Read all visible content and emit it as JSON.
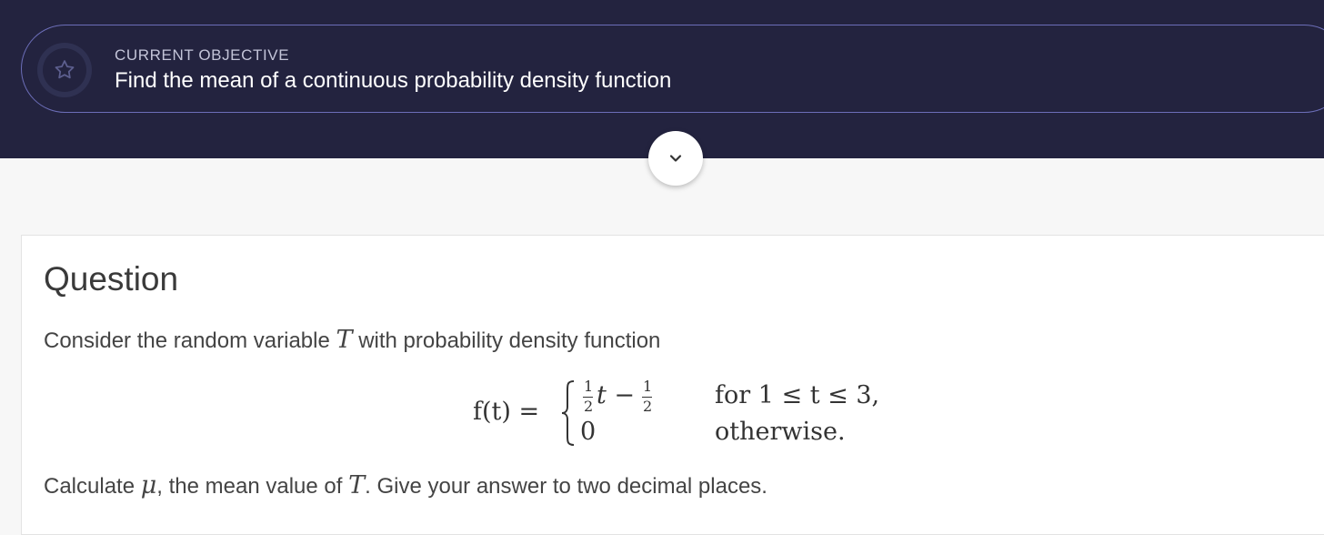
{
  "header": {
    "objective_label": "CURRENT OBJECTIVE",
    "objective_title": "Find the mean of a continuous probability density function",
    "badge_icon": "star-icon",
    "expand_icon": "chevron-down-icon"
  },
  "question": {
    "heading": "Question",
    "intro_before": "Consider the random variable",
    "variable": "T",
    "intro_after": "with probability density function",
    "formula": {
      "lhs": "f(t) =",
      "case1_fraction_num": "1",
      "case1_fraction_den": "2",
      "case1_var": "t −",
      "case1_const_num": "1",
      "case1_const_den": "2",
      "case1_condition": "for 1 ≤ t ≤ 3,",
      "case2_value": "0",
      "case2_condition": "otherwise."
    },
    "prompt_before": "Calculate",
    "mu_symbol": "μ",
    "prompt_middle": ", the mean value of",
    "prompt_variable": "T",
    "prompt_after": ". Give your answer to two decimal places."
  },
  "colors": {
    "header_bg": "#23233f",
    "pill_border": "#6c6eb8",
    "page_bg": "#f7f7f7",
    "card_bg": "#ffffff"
  }
}
